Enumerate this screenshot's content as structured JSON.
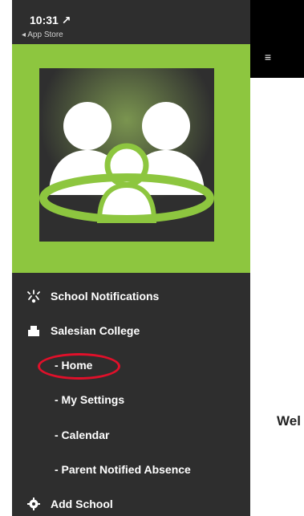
{
  "status": {
    "time": "10:31 ↗",
    "back_label": "◂ App Store"
  },
  "drawer": {
    "menu": [
      {
        "label": "School Notifications",
        "icon": "notifications-icon"
      },
      {
        "label": "Salesian College",
        "icon": "building-icon"
      },
      {
        "label": "- Home"
      },
      {
        "label": "- My Settings"
      },
      {
        "label": "- Calendar"
      },
      {
        "label": "- Parent Notified Absence"
      },
      {
        "label": "Add School",
        "icon": "gear-icon"
      }
    ]
  },
  "main": {
    "welcome_text": "Wel"
  },
  "colors": {
    "accent": "#8dc63f",
    "drawer_bg": "#2e2e2e",
    "highlight": "#e0102a"
  }
}
